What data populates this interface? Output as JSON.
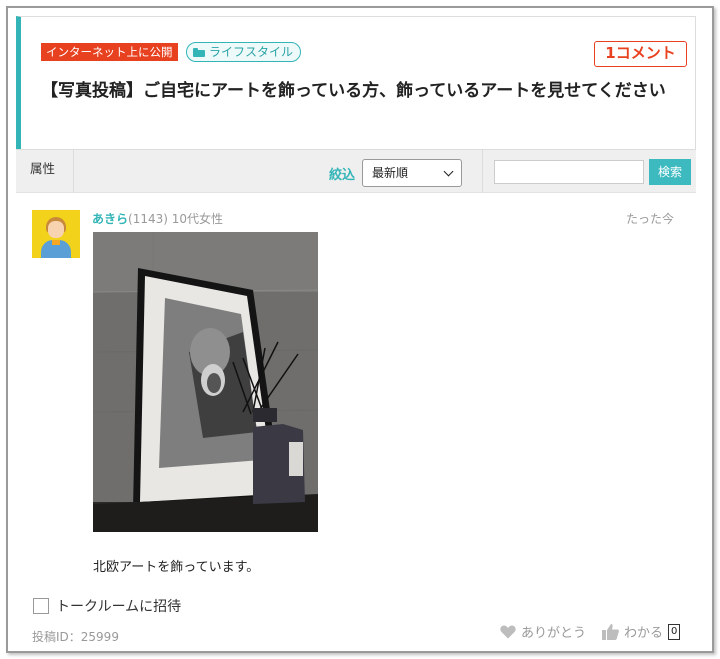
{
  "thread": {
    "visibility_badge": "インターネット上に公開",
    "category": "ライフスタイル",
    "comment_count": "1コメント",
    "title": "【写真投稿】ご自宅にアートを飾っている方、飾っているアートを見せてください"
  },
  "filter": {
    "attribute_label": "属性",
    "sort_label": "絞込",
    "sort_value": "最新順",
    "search_button": "検索",
    "search_placeholder": ""
  },
  "post": {
    "user_name": "あきら",
    "user_count": "(1143)",
    "user_attr": "10代女性",
    "time": "たった今",
    "text": "北欧アートを飾っています。",
    "invite_label": "トークルームに招待",
    "post_id": "投稿ID：25999",
    "thanks_label": "ありがとう",
    "understand_label": "わかる",
    "understand_count": "0"
  },
  "colors": {
    "accent": "#33b5b8",
    "badge_red": "#e8411f"
  }
}
